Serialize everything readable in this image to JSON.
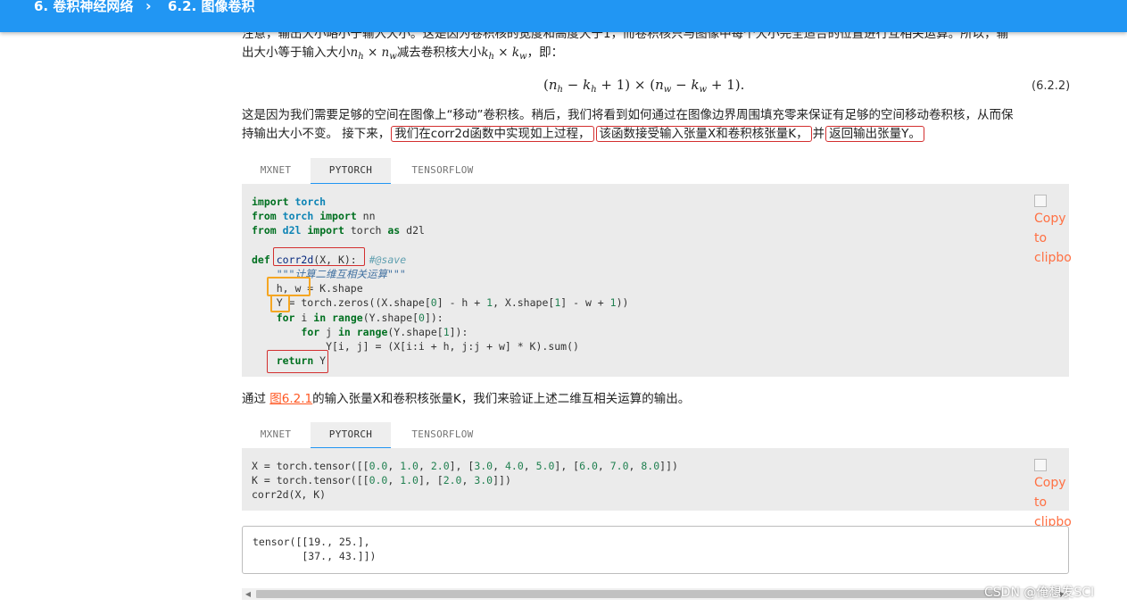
{
  "header": {
    "chapter": "6. 卷积神经网络",
    "separator": "›",
    "section": "6.2. 图像卷积"
  },
  "intro": {
    "line1": "注意，输出大小略小于输入大小。这是因为卷积核的宽度和高度大于1，而卷积核只与图像中每个大小完全适合的位置进行互相关运算。所以，输",
    "line2_a": "出大小等于输入大小",
    "line2_b": "减去卷积核大小",
    "line2_c": "，即："
  },
  "formula": {
    "text": "(n",
    "eqnum": "(6.2.2)"
  },
  "para2": {
    "line1": "这是因为我们需要足够的空间在图像上“移动”卷积核。稍后，我们将看到如何通过在图像边界周围填充零来保证有足够的空间移动卷积核，从而保",
    "line2_a": "持输出大小不变。 接下来，",
    "line2_b": "我们在corr2d函数中实现如上过程，",
    "line2_c": "该函数接受输入张量X和卷积核张量K，",
    "line2_d": "并",
    "line2_e": "返回输出张量Y。"
  },
  "tabs": [
    "MXNET",
    "PYTORCH",
    "TENSORFLOW"
  ],
  "copy_button": {
    "line1": "Copy",
    "line2": "to",
    "line3": "clipbo"
  },
  "para3": {
    "a": "通过 ",
    "link": "图6.2.1",
    "b": "的输入张量X和卷积核张量K，我们来验证上述二维互相关运算的输出。"
  },
  "output_block": {
    "line1": "tensor([[19., 25.],",
    "line2": "        [37., 43.]])"
  },
  "watermark": "CSDN @俺想发SCI",
  "colors": {
    "header_bg": "#2196f3",
    "tab_active_underline": "#2196f3",
    "annotation_red": "#d32f2f",
    "annotation_orange": "#f5a623",
    "link": "#ff5722"
  }
}
